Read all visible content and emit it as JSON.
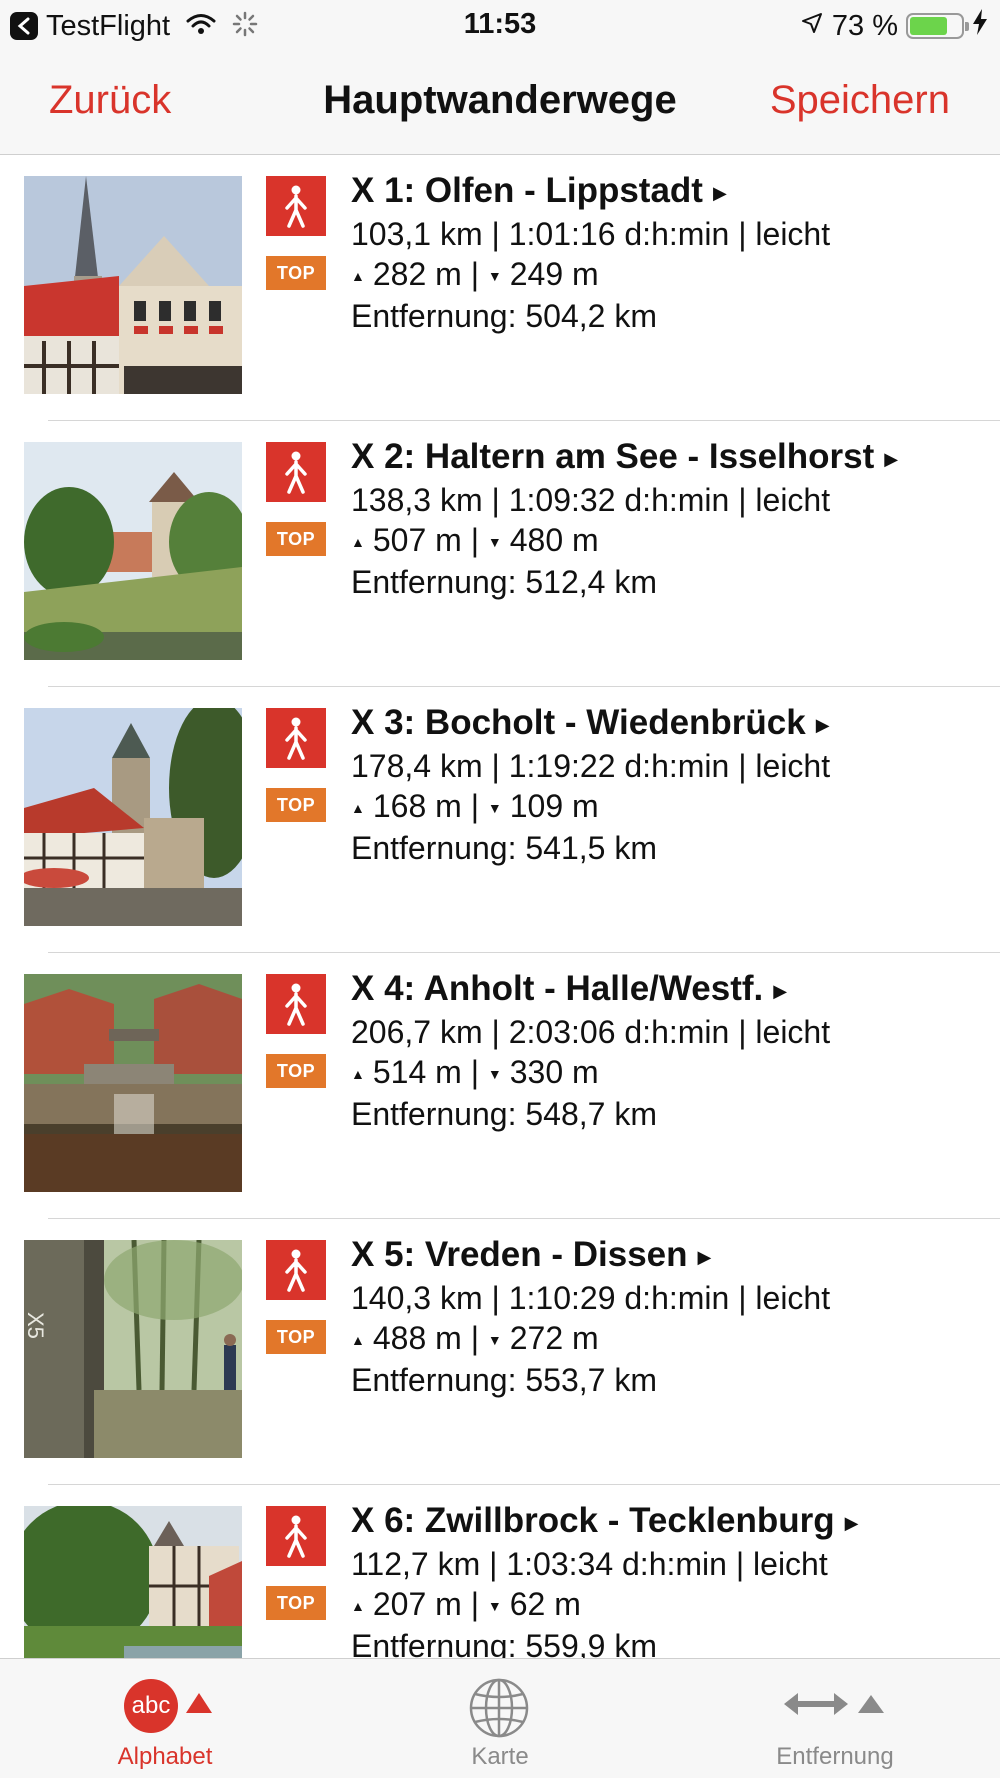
{
  "status_bar": {
    "app_name": "TestFlight",
    "time": "11:53",
    "battery": "73 %",
    "battery_level": 0.73
  },
  "nav": {
    "back_label": "Zurück",
    "title": "Hauptwanderwege",
    "save_label": "Speichern"
  },
  "colors": {
    "accent": "#d9342b",
    "top_badge": "#e2772a",
    "battery_green": "#6cd44b"
  },
  "icons": {
    "walk": "hiker-icon",
    "disclosure": "triangle-right-icon",
    "ascent": "triangle-up-icon",
    "descent": "triangle-down-icon"
  },
  "routes": [
    {
      "title": "X 1: Olfen - Lippstadt",
      "stats": "103,1 km | 1:01:16 d:h:min | leicht",
      "up": "282 m",
      "down": "249 m",
      "distance": "Entfernung: 504,2 km",
      "badge": "TOP"
    },
    {
      "title": "X 2: Haltern am See - Isselhorst",
      "stats": "138,3 km | 1:09:32 d:h:min | leicht",
      "up": "507 m",
      "down": "480 m",
      "distance": "Entfernung: 512,4 km",
      "badge": "TOP"
    },
    {
      "title": "X 3: Bocholt - Wiedenbrück",
      "stats": "178,4 km | 1:19:22 d:h:min | leicht",
      "up": "168 m",
      "down": "109 m",
      "distance": "Entfernung: 541,5 km",
      "badge": "TOP"
    },
    {
      "title": "X 4: Anholt - Halle/Westf.",
      "stats": "206,7 km | 2:03:06 d:h:min | leicht",
      "up": "514 m",
      "down": "330 m",
      "distance": "Entfernung: 548,7 km",
      "badge": "TOP"
    },
    {
      "title": "X 5: Vreden - Dissen",
      "stats": "140,3 km | 1:10:29 d:h:min | leicht",
      "up": "488 m",
      "down": "272 m",
      "distance": "Entfernung: 553,7 km",
      "badge": "TOP"
    },
    {
      "title": "X 6: Zwillbrock - Tecklenburg",
      "stats": "112,7 km | 1:03:34 d:h:min | leicht",
      "up": "207 m",
      "down": "62 m",
      "distance": "Entfernung: 559,9 km",
      "badge": "TOP"
    }
  ],
  "tabs": {
    "alphabet": {
      "label": "Alphabet",
      "icon_text": "abc"
    },
    "karte": {
      "label": "Karte"
    },
    "entfernung": {
      "label": "Entfernung"
    }
  }
}
